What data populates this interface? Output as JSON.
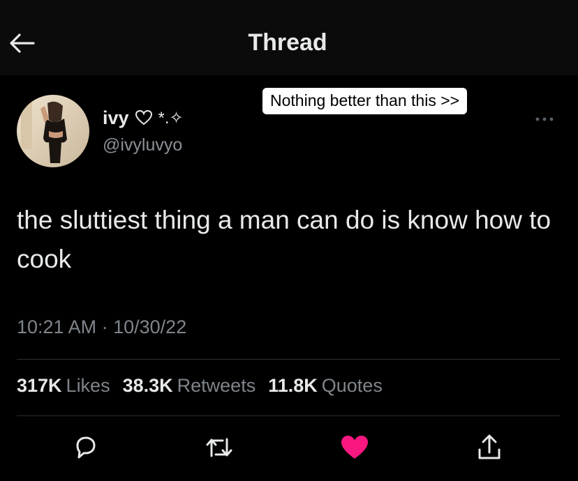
{
  "header": {
    "title": "Thread",
    "back_icon": "arrow-left-icon"
  },
  "overlay_caption": "Nothing better than this >>",
  "author": {
    "display_name": "ivy",
    "name_decoration": "*.✧",
    "handle": "@ivyluvyo",
    "avatar_icon": "avatar"
  },
  "tweet": {
    "text": "the sluttiest thing a man can do is know how to cook",
    "time": "10:21 AM",
    "separator": "·",
    "date": "10/30/22"
  },
  "stats": {
    "likes_count": "317K",
    "likes_label": "Likes",
    "retweets_count": "38.3K",
    "retweets_label": "Retweets",
    "quotes_count": "11.8K",
    "quotes_label": "Quotes"
  },
  "actions": {
    "reply_icon": "reply-icon",
    "retweet_icon": "retweet-icon",
    "like_icon": "heart-icon",
    "share_icon": "share-icon",
    "liked": true
  },
  "colors": {
    "background": "#000000",
    "text": "#e7e9ea",
    "secondary_text": "#7f858b",
    "like": "#f91880"
  }
}
